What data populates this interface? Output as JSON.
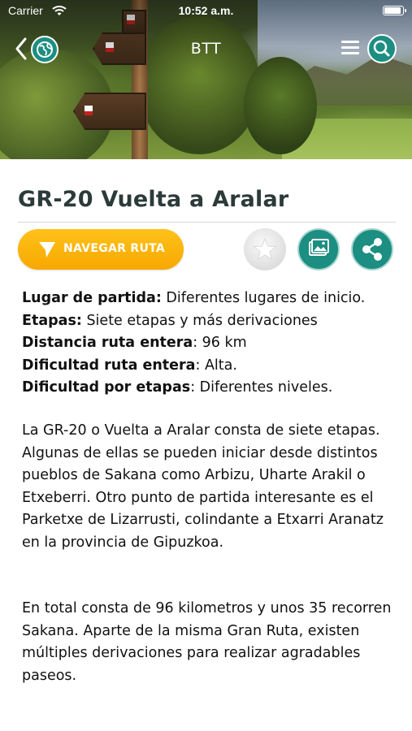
{
  "status_bar": {
    "carrier": "Carrier",
    "time": "10:52 a.m.",
    "battery_level": 1.0
  },
  "nav": {
    "title": "BTT",
    "back_icon": "chevron-left-icon",
    "globe_icon": "globe-icon",
    "menu_icon": "hamburger-menu-icon",
    "search_icon": "search-icon"
  },
  "route": {
    "title": "GR-20 Vuelta a Aralar",
    "navigate_label": "NAVEGAR RUTA",
    "actions": {
      "favorite_icon": "star-icon",
      "gallery_icon": "gallery-icon",
      "share_icon": "share-icon"
    },
    "details": [
      {
        "label": "Lugar de partida:",
        "value": " Diferentes lugares de inicio."
      },
      {
        "label": "Etapas:",
        "value": " Siete etapas y más derivaciones"
      },
      {
        "label": "Distancia ruta entera",
        "value": ": 96 km"
      },
      {
        "label": "Dificultad ruta entera",
        "value": ": Alta."
      },
      {
        "label": "Dificultad por etapas",
        "value": ": Diferentes niveles."
      }
    ],
    "description": [
      "La GR-20 o Vuelta a Aralar consta de siete etapas. Algunas de ellas se pueden iniciar desde distintos pueblos de Sakana como Arbizu, Uharte Arakil o Etxeberri. Otro punto de partida interesante es el Parketxe de Lizarrusti, colindante a Etxarri Aranatz en la provincia de Gipuzkoa.",
      "En total consta de 96 kilometros y unos 35 recorren Sakana. Aparte de la misma Gran Ruta, existen múltiples derivaciones para realizar agradables paseos."
    ]
  },
  "colors": {
    "accent_teal": "#1c8e82",
    "accent_yellow": "#f7a800",
    "title_color": "#2c3b3a"
  }
}
